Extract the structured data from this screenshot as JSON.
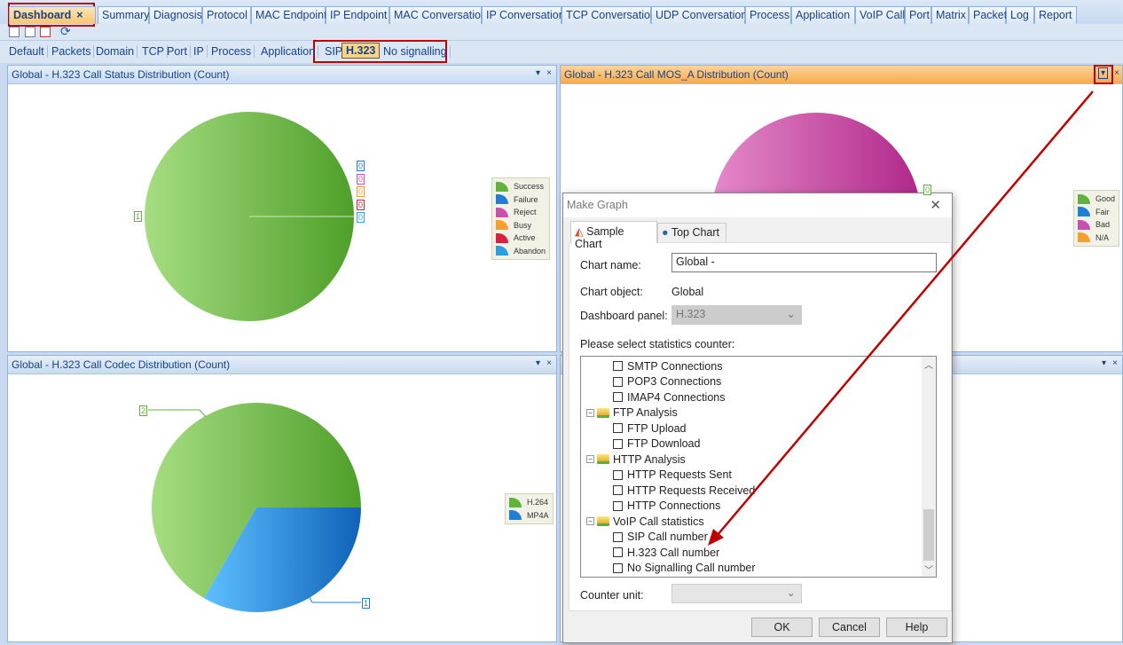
{
  "tabs": [
    "Dashboard",
    "Summary",
    "Diagnosis",
    "Protocol",
    "MAC Endpoint",
    "IP Endpoint",
    "MAC Conversation",
    "IP Conversation",
    "TCP Conversation",
    "UDP Conversation",
    "Process",
    "Application",
    "VoIP Call",
    "Port",
    "Matrix",
    "Packet",
    "Log",
    "Report"
  ],
  "active_tab": "Dashboard",
  "tab_close": "×",
  "subtabs": [
    "Default",
    "Packets",
    "Domain",
    "TCP",
    "Port",
    "IP",
    "Process",
    "Application",
    "SIP",
    "H.323",
    "No signalling"
  ],
  "active_subtab": "H.323",
  "panels": {
    "status": {
      "title": "Global - H.323 Call Status Distribution (Count)",
      "chart_data": {
        "type": "pie",
        "categories": [
          "Success",
          "Failure",
          "Reject",
          "Busy",
          "Active",
          "Abandon"
        ],
        "values": [
          1,
          0,
          0,
          0,
          0,
          0
        ],
        "colors": [
          "#5fb33c",
          "#1e7fd6",
          "#c94fb0",
          "#f5a02c",
          "#d9223c",
          "#2aa0e0"
        ]
      }
    },
    "mos": {
      "title": "Global - H.323 Call MOS_A Distribution (Count)",
      "chart_data": {
        "type": "pie",
        "categories": [
          "Good",
          "Fair",
          "Bad",
          "N/A"
        ],
        "values": [
          0,
          0,
          1,
          0
        ],
        "colors": [
          "#5fb33c",
          "#1e7fd6",
          "#c94fb0",
          "#f5a02c"
        ],
        "visible_label": "0"
      }
    },
    "codec": {
      "title": "Global - H.323 Call Codec Distribution (Count)",
      "chart_data": {
        "type": "pie",
        "categories": [
          "H.264",
          "MP4A"
        ],
        "values": [
          2,
          1
        ],
        "colors": [
          "#5fb33c",
          "#1e7fd6"
        ]
      }
    }
  },
  "panel_buttons": {
    "menu": "▾",
    "close": "×"
  },
  "dialog": {
    "title": "Make Graph",
    "close": "✕",
    "tabs": [
      "Sample Chart",
      "Top Chart"
    ],
    "chart_name_label": "Chart name:",
    "chart_name_value": "Global -",
    "chart_object_label": "Chart object:",
    "chart_object_value": "Global",
    "dashboard_panel_label": "Dashboard panel:",
    "dashboard_panel_value": "H.323",
    "counter_prompt": "Please select statistics counter:",
    "tree": [
      {
        "label": "SMTP Connections",
        "level": 1
      },
      {
        "label": "POP3 Connections",
        "level": 1
      },
      {
        "label": "IMAP4 Connections",
        "level": 1
      },
      {
        "label": "FTP Analysis",
        "level": 0
      },
      {
        "label": "FTP Upload",
        "level": 1
      },
      {
        "label": "FTP Download",
        "level": 1
      },
      {
        "label": "HTTP Analysis",
        "level": 0
      },
      {
        "label": "HTTP Requests Sent",
        "level": 1
      },
      {
        "label": "HTTP Requests Received",
        "level": 1
      },
      {
        "label": "HTTP Connections",
        "level": 1
      },
      {
        "label": "VoIP Call statistics",
        "level": 0
      },
      {
        "label": "SIP Call number",
        "level": 1
      },
      {
        "label": "H.323 Call number",
        "level": 1
      },
      {
        "label": "No Signalling Call number",
        "level": 1
      }
    ],
    "counter_unit_label": "Counter unit:",
    "counter_unit_value": "",
    "ok": "OK",
    "cancel": "Cancel",
    "help": "Help"
  },
  "annotation_color": "#c00000"
}
